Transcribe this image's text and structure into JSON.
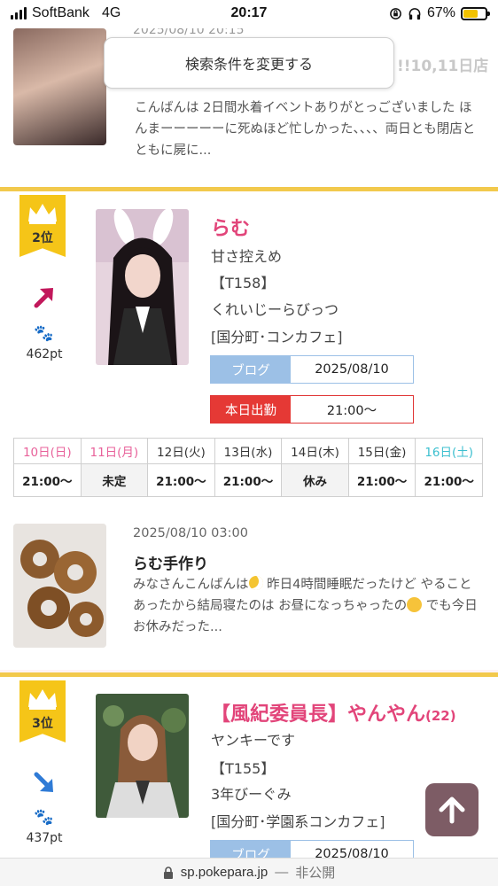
{
  "status_bar": {
    "carrier": "SoftBank",
    "network": "4G",
    "time": "20:17",
    "battery": "67%",
    "battery_level": 0.67
  },
  "search_button": "検索条件を変更する",
  "previous_post": {
    "date": "2025/08/10 20:15",
    "title_fragment": "!!10,11日店",
    "body": "こんばんは 2日間水着イベントありがとっございました ほんまーーーーーに死ぬほど忙しかった、、、、両日とも閉店とともに屍に..."
  },
  "rankings": [
    {
      "rank": "2位",
      "trend": "up",
      "points": "462pt",
      "name": "らむ",
      "age": "",
      "catchphrase": "甘さ控えめ",
      "height": "【T158】",
      "shop": "くれいじーらびっつ",
      "area": "[国分町･コンカフェ]",
      "blog_label": "ブログ",
      "blog_date": "2025/08/10",
      "work_label": "本日出勤",
      "work_time": "21:00〜",
      "schedule": {
        "days": [
          {
            "label": "10日(日)",
            "type": "sun"
          },
          {
            "label": "11日(月)",
            "type": "sun"
          },
          {
            "label": "12日(火)",
            "type": "weekday"
          },
          {
            "label": "13日(水)",
            "type": "weekday"
          },
          {
            "label": "14日(木)",
            "type": "weekday"
          },
          {
            "label": "15日(金)",
            "type": "weekday"
          },
          {
            "label": "16日(土)",
            "type": "sat"
          }
        ],
        "times": [
          "21:00〜",
          "未定",
          "21:00〜",
          "21:00〜",
          "休み",
          "21:00〜",
          "21:00〜"
        ]
      },
      "blog_post": {
        "date": "2025/08/10 03:00",
        "title": "らむ手作り",
        "body_1": "みなさんこんばんは",
        "body_2": " 昨日4時間睡眠だったけど やることあったから結局寝たのは お昼になっちゃったの",
        "body_3": " でも今日お休みだった..."
      }
    },
    {
      "rank": "3位",
      "trend": "down",
      "points": "437pt",
      "name": "【風紀委員長】やんやん",
      "age": "(22)",
      "catchphrase": "ヤンキーです",
      "height": "【T155】",
      "shop": "3年びーぐみ",
      "area": "[国分町･学園系コンカフェ]",
      "blog_label": "ブログ",
      "blog_date": "2025/08/10"
    }
  ],
  "url_bar": {
    "domain": "sp.pokepara.jp",
    "separator": "—",
    "privacy": "非公開"
  },
  "colors": {
    "accent_pink": "#e2457a",
    "rank_gold": "#f5c518",
    "blog_blue": "#9cc0e6",
    "work_red": "#e53935",
    "trend_up": "#c2185b",
    "trend_down": "#2f7bd6"
  }
}
